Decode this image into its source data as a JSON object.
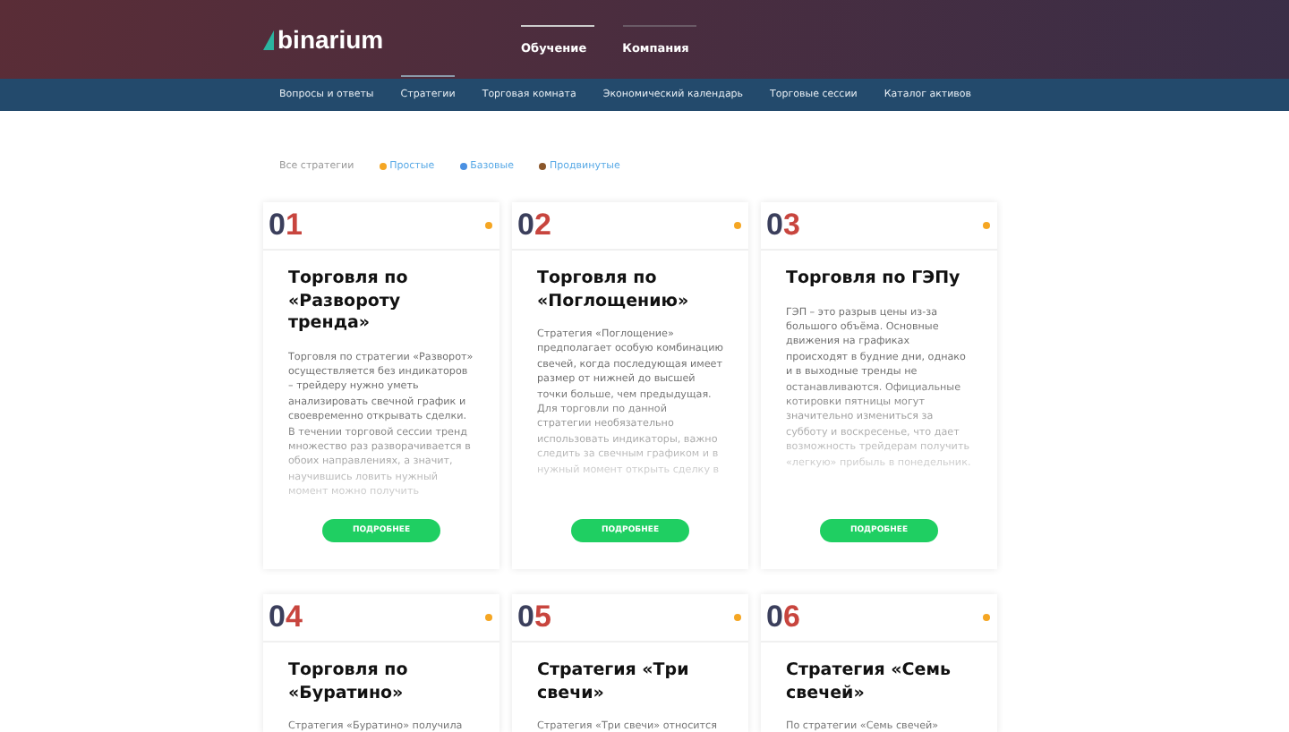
{
  "header": {
    "logo": "binarium",
    "nav": [
      {
        "label": "Обучение",
        "selected": true
      },
      {
        "label": "Компания",
        "selected": false
      }
    ]
  },
  "subnav": [
    {
      "label": "Вопросы и ответы",
      "selected": false
    },
    {
      "label": "Стратегии",
      "selected": true
    },
    {
      "label": "Торговая комната",
      "selected": false
    },
    {
      "label": "Экономический календарь",
      "selected": false
    },
    {
      "label": "Торговые сессии",
      "selected": false
    },
    {
      "label": "Каталог активов",
      "selected": false
    }
  ],
  "filters": {
    "all": "Все стратегии",
    "levels": [
      {
        "label": "Простые",
        "color": "#f5a623"
      },
      {
        "label": "Базовые",
        "color": "#4a90e2"
      },
      {
        "label": "Продвинутые",
        "color": "#8b572a"
      }
    ]
  },
  "cards": [
    {
      "number_lead": "0",
      "number_digit": "1",
      "kind": "simple",
      "title": "Торговля по «Развороту тренда»",
      "body": "Торговля по стратегии «Разворот» осуществляется без индикаторов – трейдеру нужно уметь анализировать свечной график и своевременно открывать сделки. В течении торговой сессии тренд множество раз разворачивается в обоих направлениях, а значит, научившись ловить нужный момент можно получить",
      "button": "ПОДРОБНЕЕ"
    },
    {
      "number_lead": "0",
      "number_digit": "2",
      "kind": "simple",
      "title": "Торговля по «Поглощению»",
      "body": "Стратегия «Поглощение» предполагает особую комбинацию свечей, когда последующая имеет размер от нижней до высшей точки больше, чем предыдущая. Для торговли по данной стратегии необязательно использовать индикаторы, важно следить за свечным графиком и в нужный момент открыть сделку в",
      "button": "ПОДРОБНЕЕ"
    },
    {
      "number_lead": "0",
      "number_digit": "3",
      "kind": "simple",
      "title": "Торговля по ГЭПу",
      "body": "ГЭП – это разрыв цены из-за большого объёма. Основные движения на графиках происходят в будние дни, однако и в выходные тренды не останавливаются. Официальные котировки пятницы могут значительно измениться за субботу и воскресенье, что дает возможность трейдерам получить «легкую» прибыль в понедельник.",
      "button": "ПОДРОБНЕЕ"
    },
    {
      "number_lead": "0",
      "number_digit": "4",
      "kind": "simple",
      "title": "Торговля по «Буратино»",
      "body": "Стратегия «Буратино» получила"
    },
    {
      "number_lead": "0",
      "number_digit": "5",
      "kind": "simple",
      "title": "Стратегия «Три свечи»",
      "body": "Стратегия «Три свечи» относится"
    },
    {
      "number_lead": "0",
      "number_digit": "6",
      "kind": "simple",
      "title": "Стратегия «Семь свечей»",
      "body": "По стратегии «Семь свечей»"
    }
  ]
}
